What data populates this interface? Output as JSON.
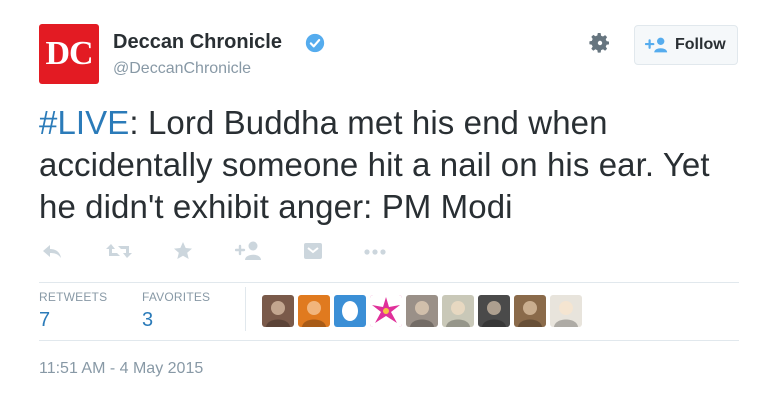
{
  "account": {
    "logo_text": "DC",
    "name": "Deccan Chronicle",
    "handle": "@DeccanChronicle",
    "verified": true
  },
  "header": {
    "follow_label": "Follow",
    "settings_icon": "gear-icon"
  },
  "tweet": {
    "hashtag": "#LIVE",
    "text_rest": ": Lord Buddha met his end when accidentally someone hit a nail on his ear. Yet he didn't exhibit anger: PM Modi"
  },
  "actions": [
    "reply-icon",
    "retweet-icon",
    "favorite-icon",
    "follow-user-icon",
    "card-icon",
    "more-icon"
  ],
  "stats": {
    "retweets_label": "RETWEETS",
    "retweets_value": "7",
    "favorites_label": "FAVORITES",
    "favorites_value": "3"
  },
  "avatars": [
    {
      "name": "avatar-1",
      "color": "#7a5a4a"
    },
    {
      "name": "avatar-2",
      "color": "#e07a1f"
    },
    {
      "name": "avatar-3",
      "color": "#3b8fd6"
    },
    {
      "name": "avatar-4",
      "color": "#e0309a"
    },
    {
      "name": "avatar-5",
      "color": "#9a9088"
    },
    {
      "name": "avatar-6",
      "color": "#c9c8b8"
    },
    {
      "name": "avatar-7",
      "color": "#4a4a4a"
    },
    {
      "name": "avatar-8",
      "color": "#8a6a4a"
    },
    {
      "name": "avatar-9",
      "color": "#e8e4dc"
    }
  ],
  "timestamp": "11:51 AM - 4 May 2015",
  "colors": {
    "accent": "#2b7bb9",
    "brand_red": "#e31b23",
    "muted": "#8899a6",
    "icon": "#ccd6dd",
    "text": "#292f33"
  }
}
